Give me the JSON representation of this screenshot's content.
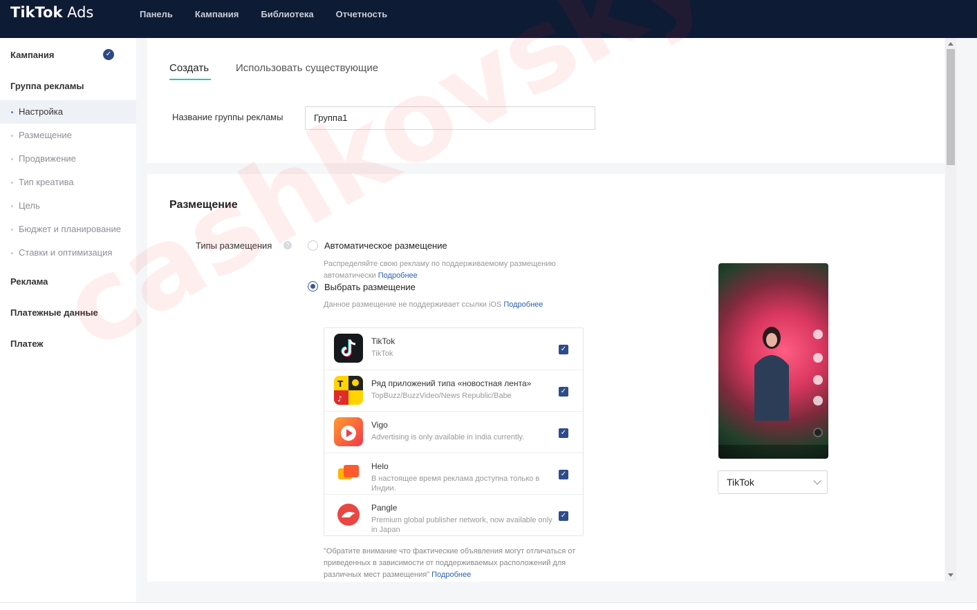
{
  "header": {
    "logo_bold": "TikTok",
    "logo_light": "Ads",
    "nav": [
      "Панель",
      "Кампания",
      "Библиотека",
      "Отчетность"
    ]
  },
  "sidebar": {
    "campaign": "Кампания",
    "adgroup": "Группа рекламы",
    "items": [
      "Настройка",
      "Размещение",
      "Продвижение",
      "Тип креатива",
      "Цель",
      "Бюджет и планирование",
      "Ставки и оптимизация"
    ],
    "ad": "Реклама",
    "billing": "Платежные данные",
    "payment": "Платеж"
  },
  "tabs": {
    "create": "Создать",
    "use_existing": "Использовать существующие"
  },
  "form": {
    "name_label": "Название группы рекламы",
    "name_value": "Группа1"
  },
  "placement": {
    "title": "Размещение",
    "types_label": "Типы размещения",
    "auto_label": "Автоматическое размещение",
    "auto_hint": "Распределяйте свою рекламу по поддерживаемому размещению автоматически",
    "select_label": "Выбрать размещение",
    "select_hint": "Данное размещение не поддерживает ссылки iOS",
    "more": "Подробнее",
    "apps": [
      {
        "name": "TikTok",
        "desc": "TikTok"
      },
      {
        "name": "Ряд приложений типа «новостная лента»",
        "desc": "TopBuzz/BuzzVideo/News Republic/Babe"
      },
      {
        "name": "Vigo",
        "desc": "Advertising is only available in India currently."
      },
      {
        "name": "Helo",
        "desc": "В настоящее время реклама доступна только в Индии."
      },
      {
        "name": "Pangle",
        "desc": "Premium global publisher network, now available only in Japan"
      }
    ],
    "note": "\"Обратите внимание что фактические объявления могут отличаться от приведенных в зависимости от поддерживаемых расположений для различных мест размещения\"",
    "preview_select": "TikTok"
  },
  "watermark": "cashkovsky"
}
